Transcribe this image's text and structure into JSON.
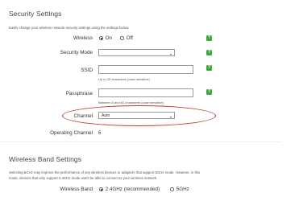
{
  "security": {
    "title": "Security Settings",
    "description": "Easily change your wireless network security settings using the settings below.",
    "wireless": {
      "label": "Wireless",
      "options": [
        "On",
        "Off"
      ],
      "selected": "On"
    },
    "security_mode": {
      "label": "Security Mode",
      "value": ""
    },
    "ssid": {
      "label": "SSID",
      "value": "",
      "hint": "Up to 32 characters (case sensitive)"
    },
    "passphrase": {
      "label": "Passphrase",
      "value": "",
      "hint": "Between 8 and 63 characters (case sensitive)"
    },
    "channel": {
      "label": "Channel",
      "value": "Auto"
    },
    "operating_channel": {
      "label": "Operating Channel",
      "value": "6"
    },
    "help_icon": "question-mark-icon",
    "help_color": "#3aa83a",
    "highlight_color": "#c0392b"
  },
  "wireless_band": {
    "title": "Wireless Band Settings",
    "description_line1": "Selecting 5GHz may improve the performance of any wireless devices or adapters that support 5GHz mode. However, in this",
    "description_line2": "mode, devices that only support 2.4GHz mode won't be able to connect to your wireless network.",
    "band": {
      "label": "Wireless Band",
      "options": [
        "2.4GHz (recommended)",
        "5GHz"
      ],
      "selected": "2.4GHz (recommended)"
    }
  }
}
